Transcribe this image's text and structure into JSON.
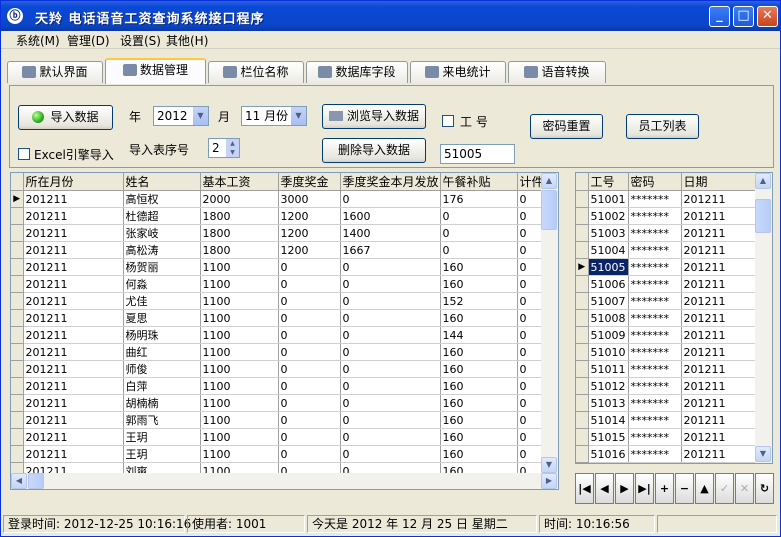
{
  "window": {
    "title": "天羚  电话语音工资查询系统接口程序",
    "icon": "app-icon"
  },
  "menu": [
    "系统(M)",
    "管理(D)",
    "设置(S)",
    "其他(H)"
  ],
  "tabs": [
    "默认界面",
    "数据管理",
    "栏位名称",
    "数据库字段",
    "来电统计",
    "语音转换"
  ],
  "active_tab": "数据管理",
  "panel": {
    "import_button": "导入数据",
    "year_label": "年",
    "year_value": "2012",
    "month_label": "月",
    "month_value": "11 月份",
    "browse_button": "浏览导入数据",
    "delete_button": "删除导入数据",
    "employee_id_label": "工  号",
    "employee_id_value": "51005",
    "reset_password_button": "密码重置",
    "employee_list_button": "员工列表",
    "excel_engine_label": "Excel引擎导入",
    "sheet_no_label": "导入表序号",
    "sheet_no_value": "2"
  },
  "salary_grid": {
    "columns": [
      "所在月份",
      "姓名",
      "基本工资",
      "季度奖金",
      "季度奖金本月发放",
      "午餐补贴",
      "计件奖"
    ],
    "rows": [
      [
        "201211",
        "高恒权",
        "2000",
        "3000",
        "0",
        "176",
        "0"
      ],
      [
        "201211",
        "杜德超",
        "1800",
        "1200",
        "1600",
        "0",
        "0"
      ],
      [
        "201211",
        "张家岐",
        "1800",
        "1200",
        "1400",
        "0",
        "0"
      ],
      [
        "201211",
        "高松涛",
        "1800",
        "1200",
        "1667",
        "0",
        "0"
      ],
      [
        "201211",
        "杨贺丽",
        "1100",
        "0",
        "0",
        "160",
        "0"
      ],
      [
        "201211",
        "何淼",
        "1100",
        "0",
        "0",
        "160",
        "0"
      ],
      [
        "201211",
        "尤佳",
        "1100",
        "0",
        "0",
        "152",
        "0"
      ],
      [
        "201211",
        "夏思",
        "1100",
        "0",
        "0",
        "160",
        "0"
      ],
      [
        "201211",
        "杨明珠",
        "1100",
        "0",
        "0",
        "144",
        "0"
      ],
      [
        "201211",
        "曲红",
        "1100",
        "0",
        "0",
        "160",
        "0"
      ],
      [
        "201211",
        "师俊",
        "1100",
        "0",
        "0",
        "160",
        "0"
      ],
      [
        "201211",
        "白萍",
        "1100",
        "0",
        "0",
        "160",
        "0"
      ],
      [
        "201211",
        "胡楠楠",
        "1100",
        "0",
        "0",
        "160",
        "0"
      ],
      [
        "201211",
        "郭雨飞",
        "1100",
        "0",
        "0",
        "160",
        "0"
      ],
      [
        "201211",
        "王玥",
        "1100",
        "0",
        "0",
        "160",
        "0"
      ],
      [
        "201211",
        "王玥",
        "1100",
        "0",
        "0",
        "160",
        "0"
      ],
      [
        "201211",
        "刘爽",
        "1100",
        "0",
        "0",
        "160",
        "0"
      ]
    ]
  },
  "employee_grid": {
    "columns": [
      "工号",
      "密码",
      "日期"
    ],
    "rows": [
      [
        "51001",
        "*******",
        "201211"
      ],
      [
        "51002",
        "*******",
        "201211"
      ],
      [
        "51003",
        "*******",
        "201211"
      ],
      [
        "51004",
        "*******",
        "201211"
      ],
      [
        "51005",
        "*******",
        "201211"
      ],
      [
        "51006",
        "*******",
        "201211"
      ],
      [
        "51007",
        "*******",
        "201211"
      ],
      [
        "51008",
        "*******",
        "201211"
      ],
      [
        "51009",
        "*******",
        "201211"
      ],
      [
        "51010",
        "*******",
        "201211"
      ],
      [
        "51011",
        "*******",
        "201211"
      ],
      [
        "51012",
        "*******",
        "201211"
      ],
      [
        "51013",
        "*******",
        "201211"
      ],
      [
        "51014",
        "*******",
        "201211"
      ],
      [
        "51015",
        "*******",
        "201211"
      ],
      [
        "51016",
        "*******",
        "201211"
      ]
    ],
    "selected_row": 4
  },
  "status": {
    "login_time": "登录时间: 2012-12-25 10:16:16",
    "user": "使用者: 1001",
    "today": "今天是 2012 年 12 月 25 日 星期二",
    "time": "时间: 10:16:56"
  },
  "colors": {
    "titlebar": "#0a48d8",
    "selection": "#0a246a",
    "window_bg": "#ece9d8"
  }
}
